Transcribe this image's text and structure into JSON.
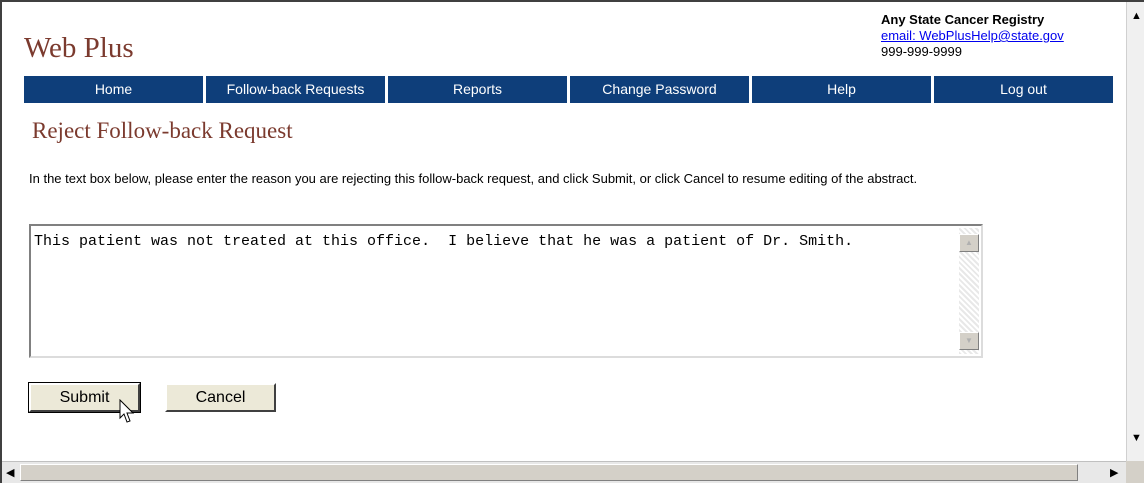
{
  "header": {
    "brand": "Web Plus",
    "registry_name": "Any State Cancer Registry",
    "registry_email": "email: WebPlusHelp@state.gov",
    "registry_phone": "999-999-9999"
  },
  "nav": {
    "items": [
      {
        "label": "Home"
      },
      {
        "label": "Follow-back Requests"
      },
      {
        "label": "Reports"
      },
      {
        "label": "Change Password"
      },
      {
        "label": "Help"
      },
      {
        "label": "Log out"
      }
    ]
  },
  "page": {
    "title": "Reject Follow-back Request",
    "instructions": "In the text box below, please enter the reason you are rejecting this follow-back request, and click Submit, or click Cancel to resume editing of the abstract.",
    "reason_text": "This patient was not treated at this office.  I believe that he was a patient of Dr. Smith."
  },
  "buttons": {
    "submit": "Submit",
    "cancel": "Cancel"
  },
  "icons": {
    "scroll_up": "scroll-up-arrow-icon",
    "scroll_down": "scroll-down-arrow-icon",
    "scroll_left": "scroll-left-arrow-icon",
    "scroll_right": "scroll-right-arrow-icon",
    "cursor": "mouse-pointer-icon"
  },
  "colors": {
    "brand": "#7b3a2e",
    "nav_bg": "#0e3e7a",
    "link": "#0000ee"
  }
}
